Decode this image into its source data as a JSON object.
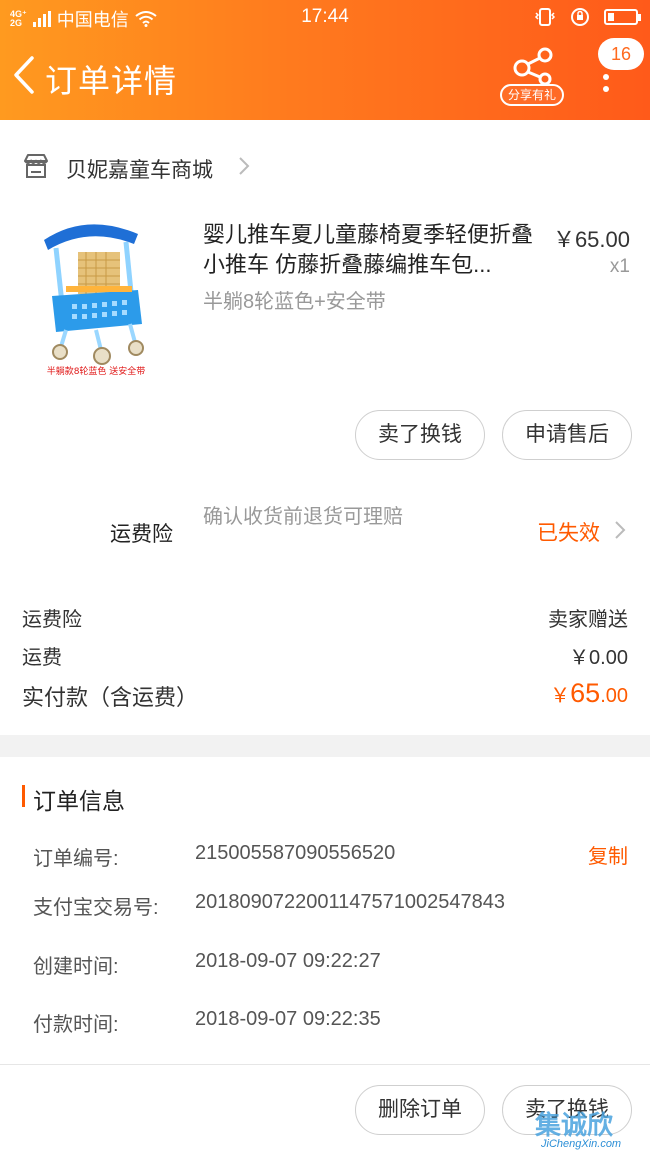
{
  "status_bar": {
    "network_small": "4G⁺\n2G",
    "carrier": "中国电信",
    "time": "17:44"
  },
  "header": {
    "title": "订单详情",
    "share_label": "分享有礼",
    "notification_count": "16"
  },
  "shop": {
    "name": "贝妮嘉童车商城"
  },
  "product": {
    "title": "婴儿推车夏儿童藤椅夏季轻便折叠小推车 仿藤折叠藤编推车包...",
    "sku": "半躺8轮蓝色+安全带",
    "price": "￥65.00",
    "quantity": "x1",
    "image_caption": "半躺款8轮蓝色 送安全带"
  },
  "item_actions": {
    "sell_label": "卖了换钱",
    "after_sale_label": "申请售后"
  },
  "insurance": {
    "label": "运费险",
    "description": "确认收货前退货可理赔",
    "status": "已失效"
  },
  "fees": {
    "insurance_label": "运费险",
    "insurance_value": "卖家赠送",
    "shipping_label": "运费",
    "shipping_value": "￥0.00",
    "paid_label": "实付款（含运费）",
    "paid_symbol": "￥",
    "paid_int": "65",
    "paid_dec": ".00"
  },
  "order_info": {
    "title": "订单信息",
    "order_no_label": "订单编号:",
    "order_no": "215005587090556520",
    "copy_label": "复制",
    "alipay_label": "支付宝交易号:",
    "alipay_no": "2018090722001147571002547843",
    "created_label": "创建时间:",
    "created_time": "2018-09-07 09:22:27",
    "paid_time_label": "付款时间:",
    "paid_time": "2018-09-07 09:22:35"
  },
  "bottom_actions": {
    "delete_label": "删除订单",
    "sell_label": "卖了换钱"
  },
  "watermark": {
    "main": "集诚欣",
    "sub": "JiChengXin.com"
  },
  "colors": {
    "header_start": "#ff9a1f",
    "header_end": "#ff5a1a",
    "accent": "#ff5a00"
  }
}
